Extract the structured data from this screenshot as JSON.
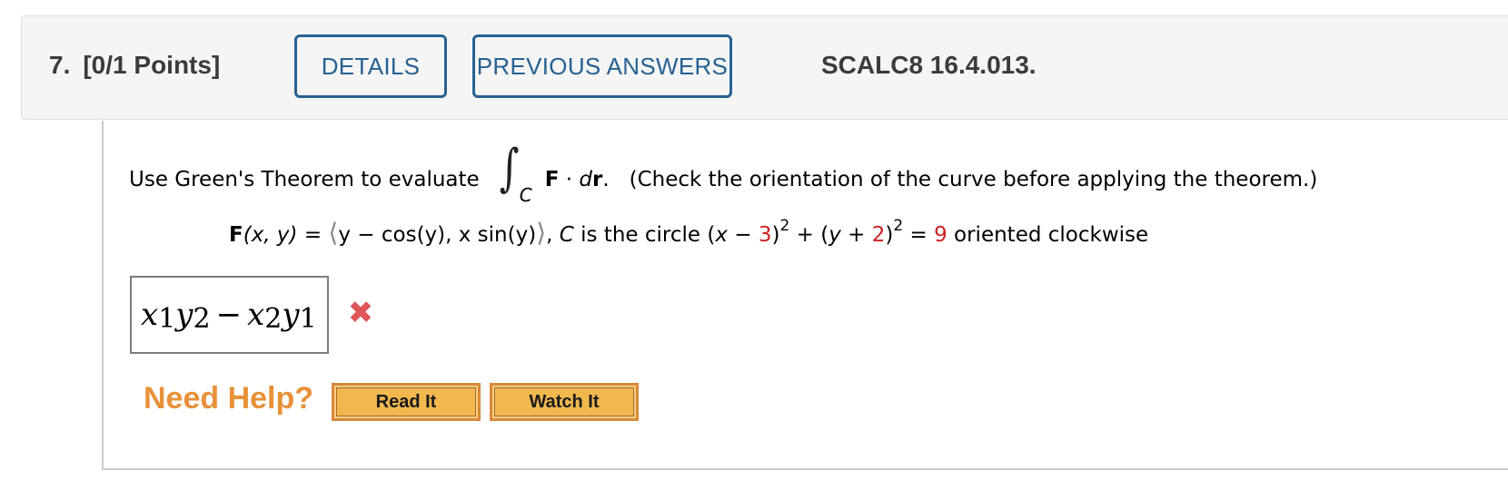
{
  "question": {
    "number": "7.",
    "points": "[0/1 Points]",
    "reference": "SCALC8 16.4.013."
  },
  "header_buttons": {
    "details": "DETAILS",
    "previous_answers": "PREVIOUS ANSWERS"
  },
  "prompt": {
    "intro": "Use Green's Theorem to evaluate",
    "integral_symbol": "∫",
    "integral_subscript": "C",
    "integrand_F": "F",
    "integrand_dot": " · ",
    "integrand_d": "d",
    "integrand_r": "r",
    "period": ".",
    "note": "(Check the orientation of the curve before applying the theorem.)"
  },
  "field": {
    "F": "F",
    "args": "(x, y)",
    "equals": " = ",
    "open_angle": "⟨",
    "first_component": "y − cos(y), x sin(y)",
    "close_angle": "⟩",
    "comma": ", ",
    "C": "C",
    "circle_text": " is the circle (",
    "x": "x",
    "minus": " − ",
    "h": "3",
    "close1": ")",
    "exp1": "2",
    "plus_open": " + (",
    "y": "y",
    "plus": " + ",
    "k": "2",
    "close2": ")",
    "exp2": "2",
    "eq": " = ",
    "r2": "9",
    "orientation": " oriented clockwise"
  },
  "answer": {
    "x": "x",
    "sub1": "1",
    "y": "y",
    "sub2": "2",
    "minus": "−",
    "x2": "x",
    "sub3": "2",
    "y2": "y",
    "sub4": "1",
    "status": "incorrect",
    "status_icon": "✖"
  },
  "help": {
    "label": "Need Help?",
    "read_it": "Read It",
    "watch_it": "Watch It"
  },
  "colors": {
    "accent_blue": "#276193",
    "highlight_red": "#cc2222",
    "help_orange": "#e8913a",
    "button_orange": "#f2b84e",
    "wrong_red": "#e05558"
  }
}
